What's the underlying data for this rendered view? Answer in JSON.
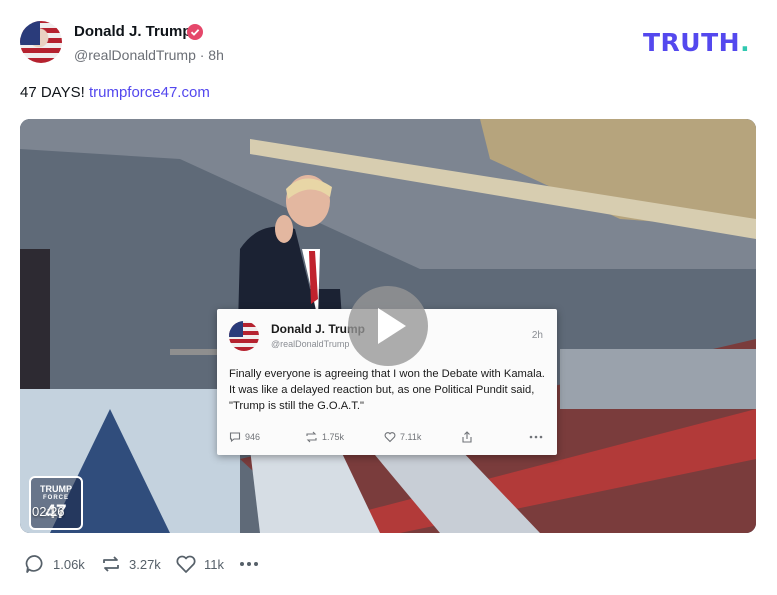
{
  "post": {
    "author_name": "Donald J. Trump",
    "handle_time": "@realDonaldTrump · 8h",
    "text": "47 DAYS!",
    "link": "trumpforce47.com"
  },
  "brand": {
    "logo_main": "TRUTH",
    "logo_dot": ".",
    "accent": "#5448ee",
    "dot_color": "#30c8b0"
  },
  "media": {
    "duration": "02:26",
    "badge_top": "TRUMP",
    "badge_mid": "FORCE",
    "badge_num": "47",
    "embedded_post": {
      "author": "Donald J. Trump",
      "handle": "@realDonaldTrump",
      "time": "2h",
      "text": "Finally everyone is agreeing that I won the Debate with Kamala. It was like a delayed reaction but, as one Political Pundit said, \"Trump is still the G.O.A.T.\"",
      "replies": "946",
      "retruths": "1.75k",
      "likes": "7.11k"
    }
  },
  "actions": {
    "replies": "1.06k",
    "retruths": "3.27k",
    "likes": "11k"
  },
  "icons": [
    "verified-badge-icon",
    "play-icon",
    "reply-icon",
    "retruth-icon",
    "heart-icon",
    "more-icon",
    "share-icon"
  ]
}
